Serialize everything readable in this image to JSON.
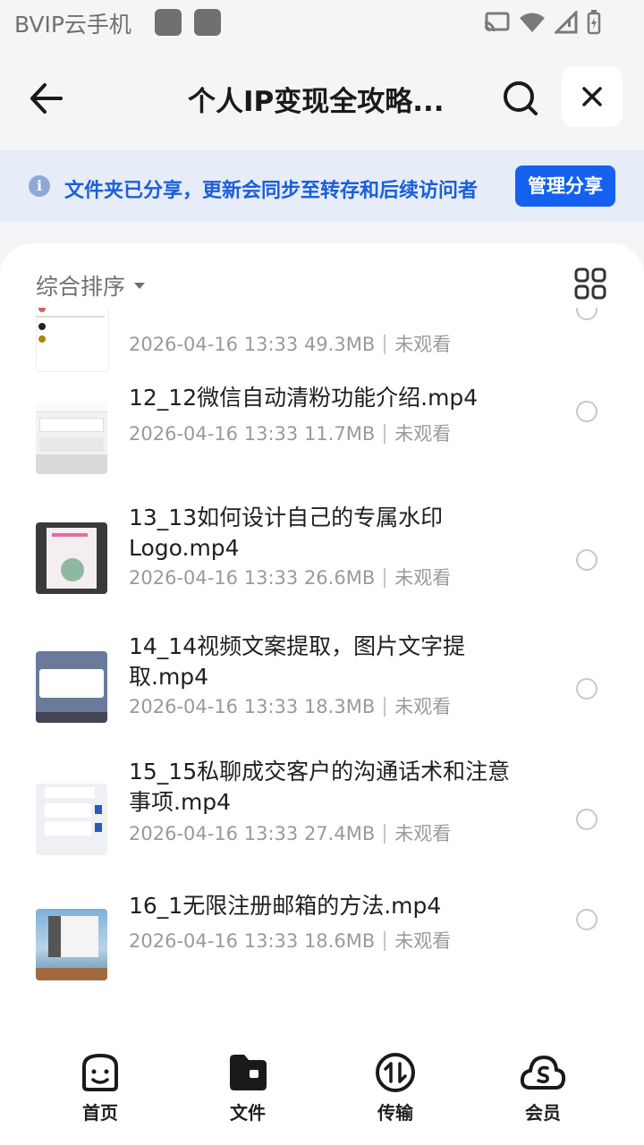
{
  "status_bar": {
    "app_name": "BVIP云手机"
  },
  "header": {
    "title": "个人IP变现全攻略..."
  },
  "share_banner": {
    "text": "文件夹已分享，更新会同步至转存和后续访问者",
    "button": "管理分享"
  },
  "toolbar": {
    "sort_label": "综合排序"
  },
  "files": [
    {
      "name": "",
      "date": "2026-04-16 13:33",
      "size": "49.3MB",
      "status": "未观看"
    },
    {
      "name": "12_12微信自动清粉功能介绍.mp4",
      "date": "2026-04-16 13:33",
      "size": "11.7MB",
      "status": "未观看"
    },
    {
      "name": "13_13如何设计自己的专属水印Logo.mp4",
      "date": "2026-04-16 13:33",
      "size": "26.6MB",
      "status": "未观看"
    },
    {
      "name": "14_14视频文案提取，图片文字提取.mp4",
      "date": "2026-04-16 13:33",
      "size": "18.3MB",
      "status": "未观看"
    },
    {
      "name": "15_15私聊成交客户的沟通话术和注意事项.mp4",
      "date": "2026-04-16 13:33",
      "size": "27.4MB",
      "status": "未观看"
    },
    {
      "name": "16_1无限注册邮箱的方法.mp4",
      "date": "2026-04-16 13:33",
      "size": "18.6MB",
      "status": "未观看"
    }
  ],
  "tabs": [
    {
      "label": "首页",
      "icon": "smile-icon"
    },
    {
      "label": "文件",
      "icon": "folder-icon"
    },
    {
      "label": "传输",
      "icon": "transfer-icon"
    },
    {
      "label": "会员",
      "icon": "vip-cloud-icon"
    }
  ]
}
